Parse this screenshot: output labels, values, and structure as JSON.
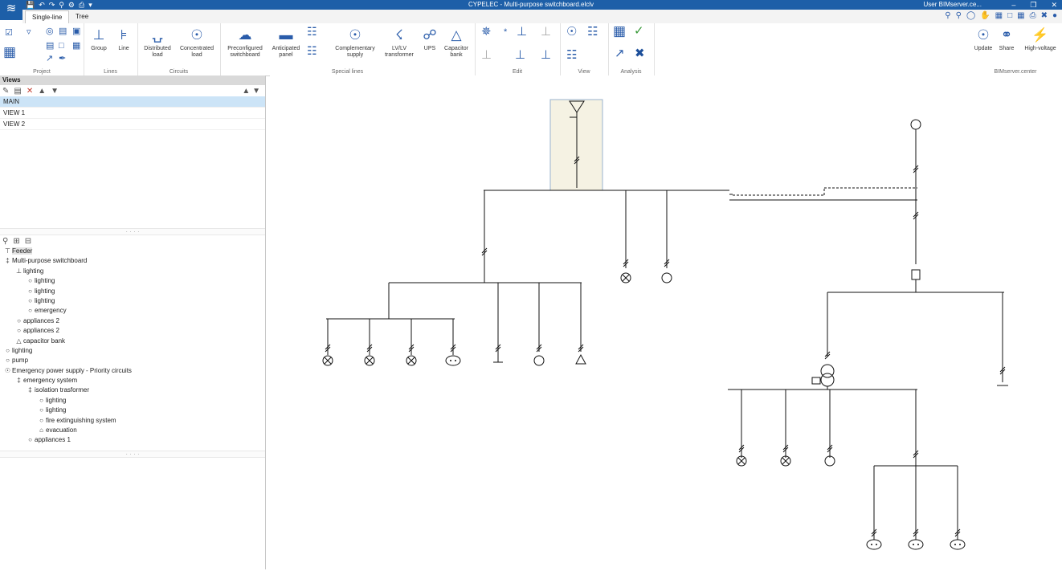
{
  "window": {
    "title": "CYPELEC - Multi-purpose switchboard.elclv",
    "user": "User BIMserver.ce..."
  },
  "tabs": [
    {
      "label": "Single-line"
    },
    {
      "label": "Tree"
    }
  ],
  "ribbon": {
    "groups": [
      {
        "label": "Project"
      },
      {
        "label": "Lines"
      },
      {
        "label": "Circuits"
      },
      {
        "label": "Special lines"
      },
      {
        "label": "Edit"
      },
      {
        "label": "View"
      },
      {
        "label": "Analysis"
      },
      {
        "label": "BIMserver.center"
      }
    ],
    "buttons": {
      "group": "Group",
      "line": "Line",
      "distributed": "Distributed load",
      "concentrated": "Concentrated load",
      "preconfigured": "Preconfigured switchboard",
      "anticipated": "Anticipated panel",
      "complementary": "Complementary supply",
      "lvlv": "LV/LV transformer",
      "ups": "UPS",
      "capacitor": "Capacitor bank",
      "update": "Update",
      "share": "Share",
      "highvoltage": "High-voltage"
    }
  },
  "views": {
    "header": "Views",
    "items": [
      "MAIN",
      "VIEW 1",
      "VIEW 2"
    ],
    "selected": "MAIN"
  },
  "tree": [
    {
      "level": 0,
      "icon": "feeder",
      "label": "Feeder",
      "highlight": true
    },
    {
      "level": 0,
      "icon": "switchboard",
      "label": "Multi-purpose switchboard"
    },
    {
      "level": 1,
      "icon": "line",
      "label": "lighting"
    },
    {
      "level": 2,
      "icon": "circle",
      "label": "lighting"
    },
    {
      "level": 2,
      "icon": "circle",
      "label": "lighting"
    },
    {
      "level": 2,
      "icon": "circle",
      "label": "lighting"
    },
    {
      "level": 2,
      "icon": "circle",
      "label": "emergency"
    },
    {
      "level": 1,
      "icon": "circle",
      "label": "appliances 2"
    },
    {
      "level": 1,
      "icon": "circle",
      "label": "appliances 2"
    },
    {
      "level": 1,
      "icon": "capacitor",
      "label": "capacitor bank"
    },
    {
      "level": 0,
      "icon": "circle",
      "label": "lighting"
    },
    {
      "level": 0,
      "icon": "circle",
      "label": "pump"
    },
    {
      "level": 0,
      "icon": "supply",
      "label": "Emergency power supply - Priority circuits"
    },
    {
      "level": 1,
      "icon": "switchboard",
      "label": "emergency system"
    },
    {
      "level": 2,
      "icon": "transformer",
      "label": "isolation trasformer"
    },
    {
      "level": 3,
      "icon": "circle",
      "label": "lighting"
    },
    {
      "level": 3,
      "icon": "circle",
      "label": "lighting"
    },
    {
      "level": 3,
      "icon": "circle",
      "label": "fire extinguishing system"
    },
    {
      "level": 3,
      "icon": "evacuation",
      "label": "evacuation"
    },
    {
      "level": 2,
      "icon": "circle",
      "label": "appliances 1"
    }
  ]
}
